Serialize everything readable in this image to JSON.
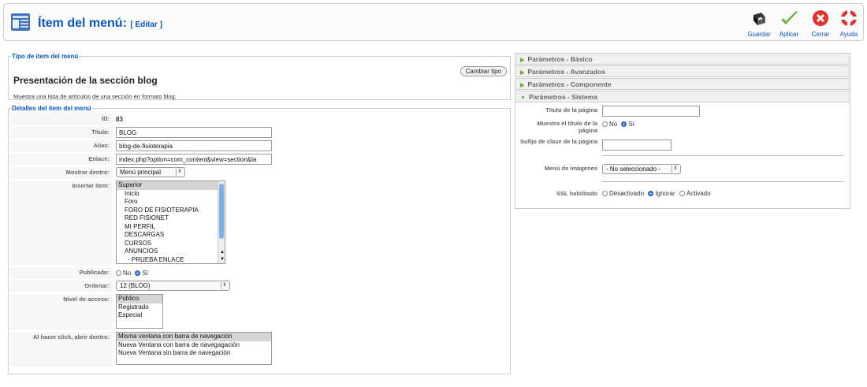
{
  "header": {
    "title": "Ítem del menú:",
    "subtitle": "[ Editar ]",
    "buttons": [
      {
        "label": "Guardar",
        "icon": "save-icon"
      },
      {
        "label": "Aplicar",
        "icon": "check-icon"
      },
      {
        "label": "Cerrar",
        "icon": "close-icon"
      },
      {
        "label": "Ayuda",
        "icon": "help-icon"
      }
    ]
  },
  "type_section": {
    "legend": "Tipo de ítem del menú",
    "title": "Presentación de la sección blog",
    "description": "Muestra una lista de artículos de una sección en formato blog.",
    "change_button": "Cambiar tipo"
  },
  "details": {
    "legend": "Detalles del ítem del menú",
    "id_label": "ID:",
    "id_value": "83",
    "titulo_label": "Título:",
    "titulo_value": "BLOG",
    "alias_label": "Alias:",
    "alias_value": "blog-de-fisioterapia",
    "enlace_label": "Enlace:",
    "enlace_value": "index.php?option=com_content&view=section&la",
    "mostrar_label": "Mostrar dentro:",
    "mostrar_value": "Menú principal",
    "insertar_label": "Insertar ítem:",
    "insertar_items": [
      "Superior",
      "Inicio",
      "Foro",
      "FORO DE FISIOTERAPIA",
      "RED FISIONET",
      "MI PERFIL",
      "DESCARGAS",
      "CURSOS",
      "ANUNCIOS",
      "- PRUEBA ENLACE"
    ],
    "publicado_label": "Publicado:",
    "publicado_no": "No",
    "publicado_si": "Sí",
    "ordenar_label": "Ordenar:",
    "ordenar_value": "12 (BLOG)",
    "nivel_label": "Nivel de acceso:",
    "nivel_items": [
      "Público",
      "Registrado",
      "Especial"
    ],
    "click_label": "Al hacer click, abrir dentro:",
    "click_items": [
      "Misma ventana con barra de navegación",
      "Nueva Ventana con barra de navegagación",
      "Nueva Ventana sin barra de navegación"
    ]
  },
  "params": {
    "basico": "Parámetros - Básico",
    "avanzados": "Parámetros - Avanzados",
    "componente": "Parámetros - Componente",
    "sistema": "Parámetros - Sistema",
    "titulo_pagina_label": "Título de la página",
    "muestra_titulo_label": "Muestra el título de la página",
    "muestra_no": "No",
    "muestra_si": "Sí",
    "sufijo_label": "Sufijo de clase de la página",
    "menu_imagenes_label": "Menú de Imágenes",
    "menu_imagenes_value": "- No seleccionado -",
    "ssl_label": "SSL habilitado",
    "ssl_desactivado": "Desactivado",
    "ssl_ignorar": "Ignorar",
    "ssl_activado": "Activado"
  }
}
